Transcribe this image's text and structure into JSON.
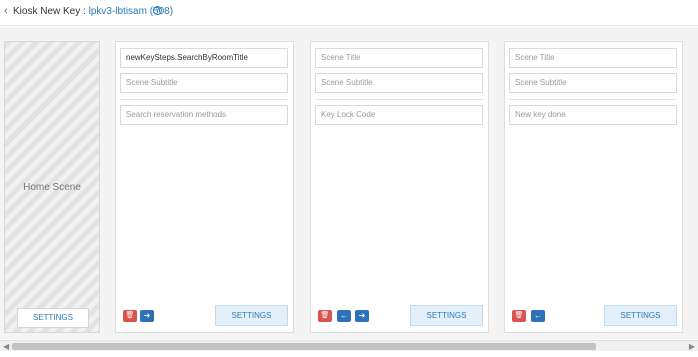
{
  "header": {
    "back_icon": "chevron-left-icon",
    "title_prefix": "Kiosk New Key : ",
    "title_link": "lpkv3-lbtisam (508)",
    "help_icon": "help-circle-icon",
    "help_glyph": "?"
  },
  "home_scene": {
    "label": "Home Scene",
    "settings_label": "SETTINGS"
  },
  "scenes": [
    {
      "title_value": "newKeySteps.SearchByRoomTitle",
      "title_placeholder": "Scene Title",
      "subtitle_placeholder": "Scene Subtitle",
      "content_placeholder": "Search reservation methods",
      "settings_label": "SETTINGS",
      "delete_glyph": "🗑",
      "next_glyph": "➜"
    },
    {
      "title_value": "",
      "title_placeholder": "Scene Title",
      "subtitle_placeholder": "Scene Subtitle",
      "content_placeholder": "Key Lock Code",
      "settings_label": "SETTINGS",
      "delete_glyph": "🗑",
      "prev_glyph": "←",
      "next_glyph": "➜"
    },
    {
      "title_value": "",
      "title_placeholder": "Scene Title",
      "subtitle_placeholder": "Scene Subtitle",
      "content_placeholder": "New key done",
      "settings_label": "SETTINGS",
      "delete_glyph": "🗑",
      "prev_glyph": "←"
    }
  ],
  "scrollbar": {
    "left_arrow": "◀",
    "right_arrow": "▶"
  },
  "colors": {
    "accent": "#2a7ab7",
    "delete": "#d9534f",
    "nav_button": "#2d72b8",
    "settings_bg": "#e4f0f9"
  }
}
